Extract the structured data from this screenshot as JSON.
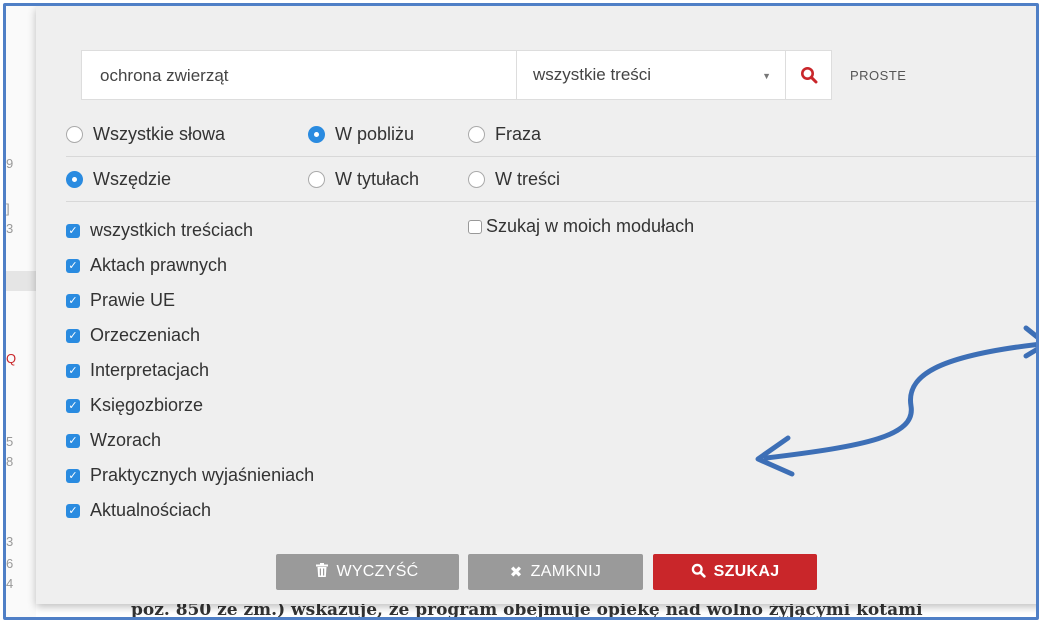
{
  "search": {
    "query": "ochrona zwierząt",
    "scope": "wszystkie treści",
    "mode_label": "PROSTE"
  },
  "match_options": [
    {
      "label": "Wszystkie słowa",
      "selected": false
    },
    {
      "label": "W pobliżu",
      "selected": true
    },
    {
      "label": "Fraza",
      "selected": false
    }
  ],
  "location_options": [
    {
      "label": "Wszędzie",
      "selected": true
    },
    {
      "label": "W tytułach",
      "selected": false
    },
    {
      "label": "W treści",
      "selected": false
    }
  ],
  "modules_checkbox": {
    "label": "Szukaj w moich modułach",
    "checked": false
  },
  "sources": [
    {
      "label": "wszystkich treściach",
      "checked": true
    },
    {
      "label": "Aktach prawnych",
      "checked": true
    },
    {
      "label": "Prawie UE",
      "checked": true
    },
    {
      "label": "Orzeczeniach",
      "checked": true
    },
    {
      "label": "Interpretacjach",
      "checked": true
    },
    {
      "label": "Księgozbiorze",
      "checked": true
    },
    {
      "label": "Wzorach",
      "checked": true
    },
    {
      "label": "Praktycznych wyjaśnieniach",
      "checked": true
    },
    {
      "label": "Aktualnościach",
      "checked": true
    }
  ],
  "buttons": {
    "clear": "WYCZYŚĆ",
    "close": "ZAMKNIJ",
    "search": "SZUKAJ"
  },
  "background": {
    "partial_text": "poz. 850 ze zm.) wskazuje, że program obejmuje opiekę nad wolno żyjącymi kotami"
  },
  "colors": {
    "accent": "#2a8be0",
    "search_button": "#c9262a",
    "neutral_button": "#9a9a9a",
    "annotation_arrow": "#3d6fb6",
    "frame": "#4f7fc6"
  }
}
